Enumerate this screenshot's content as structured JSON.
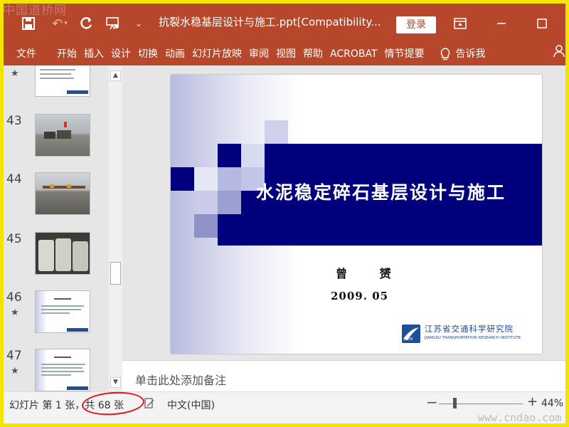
{
  "watermark": {
    "top": "中国道桥网",
    "bottom": "www.cndao.com"
  },
  "titlebar": {
    "title": "抗裂水稳基层设计与施工.ppt[Compatibility...",
    "login_label": "登录",
    "icons": [
      "save-icon",
      "undo-icon",
      "redo-icon",
      "presentation-from-start-icon",
      "customize-toolbar-icon",
      "ribbon-display-icon",
      "minimize-icon",
      "maximize-icon"
    ]
  },
  "ribbon": {
    "tabs": [
      "文件",
      "开始",
      "插入",
      "设计",
      "切换",
      "动画",
      "幻灯片放映",
      "审阅",
      "视图",
      "帮助",
      "ACROBAT",
      "情节提要"
    ],
    "tell_me": "告诉我"
  },
  "thumbnails": [
    {
      "number": "",
      "star": "★"
    },
    {
      "number": "43",
      "star": ""
    },
    {
      "number": "44",
      "star": ""
    },
    {
      "number": "45",
      "star": ""
    },
    {
      "number": "46",
      "star": "★"
    },
    {
      "number": "47",
      "star": "★"
    }
  ],
  "slide": {
    "title": "水泥稳定碎石基层设计与施工",
    "author": "曾 赟",
    "date": "2009. 05",
    "institute_cn": "江苏省交通科学研究院",
    "institute_en": "JIANGSU TRANSPORTATION RESEARCH INSTITUTE",
    "institute_logo_text": "JSTRI",
    "colors": {
      "band": "#00007d",
      "accent": "#b7472a"
    }
  },
  "notes": {
    "placeholder": "单击此处添加备注"
  },
  "status": {
    "slide_info": "幻灯片 第 1 张，共 68 张",
    "language": "中文(中国)",
    "zoom": "44%",
    "zoom_minus": "−",
    "zoom_plus": "+"
  }
}
